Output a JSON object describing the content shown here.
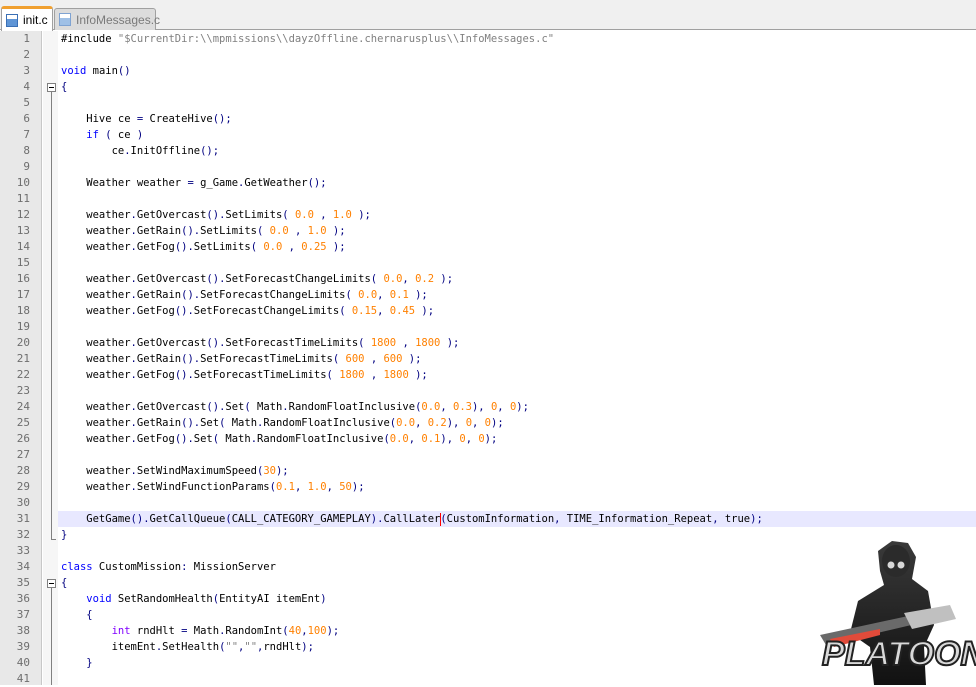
{
  "tabs": [
    {
      "label": "init.c",
      "icon": "c-file-icon",
      "active": true
    },
    {
      "label": "InfoMessages.c",
      "icon": "c-file-icon",
      "active": false
    }
  ],
  "lines": [
    {
      "n": "1",
      "t": [
        [
          "p",
          "#include "
        ],
        [
          "s",
          "\"$CurrentDir:\\\\mpmissions\\\\dayzOffline.chernarusplus\\\\InfoMessages.c\""
        ]
      ]
    },
    {
      "n": "2",
      "t": []
    },
    {
      "n": "3",
      "t": [
        [
          "k",
          "void"
        ],
        [
          "p",
          " main"
        ],
        [
          "o",
          "()"
        ]
      ]
    },
    {
      "n": "4",
      "t": [
        [
          "o",
          "{"
        ]
      ]
    },
    {
      "n": "5",
      "t": []
    },
    {
      "n": "6",
      "t": [
        [
          "p",
          "    Hive ce "
        ],
        [
          "o",
          "="
        ],
        [
          "p",
          " CreateHive"
        ],
        [
          "o",
          "();"
        ]
      ]
    },
    {
      "n": "7",
      "t": [
        [
          "p",
          "    "
        ],
        [
          "k",
          "if"
        ],
        [
          "p",
          " "
        ],
        [
          "o",
          "("
        ],
        [
          "p",
          " ce "
        ],
        [
          "o",
          ")"
        ]
      ]
    },
    {
      "n": "8",
      "t": [
        [
          "p",
          "        ce"
        ],
        [
          "o",
          "."
        ],
        [
          "p",
          "InitOffline"
        ],
        [
          "o",
          "();"
        ]
      ]
    },
    {
      "n": "9",
      "t": []
    },
    {
      "n": "10",
      "t": [
        [
          "p",
          "    Weather weather "
        ],
        [
          "o",
          "="
        ],
        [
          "p",
          " g_Game"
        ],
        [
          "o",
          "."
        ],
        [
          "p",
          "GetWeather"
        ],
        [
          "o",
          "();"
        ]
      ]
    },
    {
      "n": "11",
      "t": []
    },
    {
      "n": "12",
      "t": [
        [
          "p",
          "    weather"
        ],
        [
          "o",
          "."
        ],
        [
          "p",
          "GetOvercast"
        ],
        [
          "o",
          "()."
        ],
        [
          "p",
          "SetLimits"
        ],
        [
          "o",
          "("
        ],
        [
          "p",
          " "
        ],
        [
          "n",
          "0.0"
        ],
        [
          "p",
          " "
        ],
        [
          "o",
          ","
        ],
        [
          "p",
          " "
        ],
        [
          "n",
          "1.0"
        ],
        [
          "p",
          " "
        ],
        [
          "o",
          ");"
        ]
      ]
    },
    {
      "n": "13",
      "t": [
        [
          "p",
          "    weather"
        ],
        [
          "o",
          "."
        ],
        [
          "p",
          "GetRain"
        ],
        [
          "o",
          "()."
        ],
        [
          "p",
          "SetLimits"
        ],
        [
          "o",
          "("
        ],
        [
          "p",
          " "
        ],
        [
          "n",
          "0.0"
        ],
        [
          "p",
          " "
        ],
        [
          "o",
          ","
        ],
        [
          "p",
          " "
        ],
        [
          "n",
          "1.0"
        ],
        [
          "p",
          " "
        ],
        [
          "o",
          ");"
        ]
      ]
    },
    {
      "n": "14",
      "t": [
        [
          "p",
          "    weather"
        ],
        [
          "o",
          "."
        ],
        [
          "p",
          "GetFog"
        ],
        [
          "o",
          "()."
        ],
        [
          "p",
          "SetLimits"
        ],
        [
          "o",
          "("
        ],
        [
          "p",
          " "
        ],
        [
          "n",
          "0.0"
        ],
        [
          "p",
          " "
        ],
        [
          "o",
          ","
        ],
        [
          "p",
          " "
        ],
        [
          "n",
          "0.25"
        ],
        [
          "p",
          " "
        ],
        [
          "o",
          ");"
        ]
      ]
    },
    {
      "n": "15",
      "t": []
    },
    {
      "n": "16",
      "t": [
        [
          "p",
          "    weather"
        ],
        [
          "o",
          "."
        ],
        [
          "p",
          "GetOvercast"
        ],
        [
          "o",
          "()."
        ],
        [
          "p",
          "SetForecastChangeLimits"
        ],
        [
          "o",
          "("
        ],
        [
          "p",
          " "
        ],
        [
          "n",
          "0.0"
        ],
        [
          "o",
          ","
        ],
        [
          "p",
          " "
        ],
        [
          "n",
          "0.2"
        ],
        [
          "p",
          " "
        ],
        [
          "o",
          ");"
        ]
      ]
    },
    {
      "n": "17",
      "t": [
        [
          "p",
          "    weather"
        ],
        [
          "o",
          "."
        ],
        [
          "p",
          "GetRain"
        ],
        [
          "o",
          "()."
        ],
        [
          "p",
          "SetForecastChangeLimits"
        ],
        [
          "o",
          "("
        ],
        [
          "p",
          " "
        ],
        [
          "n",
          "0.0"
        ],
        [
          "o",
          ","
        ],
        [
          "p",
          " "
        ],
        [
          "n",
          "0.1"
        ],
        [
          "p",
          " "
        ],
        [
          "o",
          ");"
        ]
      ]
    },
    {
      "n": "18",
      "t": [
        [
          "p",
          "    weather"
        ],
        [
          "o",
          "."
        ],
        [
          "p",
          "GetFog"
        ],
        [
          "o",
          "()."
        ],
        [
          "p",
          "SetForecastChangeLimits"
        ],
        [
          "o",
          "("
        ],
        [
          "p",
          " "
        ],
        [
          "n",
          "0.15"
        ],
        [
          "o",
          ","
        ],
        [
          "p",
          " "
        ],
        [
          "n",
          "0.45"
        ],
        [
          "p",
          " "
        ],
        [
          "o",
          ");"
        ]
      ]
    },
    {
      "n": "19",
      "t": []
    },
    {
      "n": "20",
      "t": [
        [
          "p",
          "    weather"
        ],
        [
          "o",
          "."
        ],
        [
          "p",
          "GetOvercast"
        ],
        [
          "o",
          "()."
        ],
        [
          "p",
          "SetForecastTimeLimits"
        ],
        [
          "o",
          "("
        ],
        [
          "p",
          " "
        ],
        [
          "n",
          "1800"
        ],
        [
          "p",
          " "
        ],
        [
          "o",
          ","
        ],
        [
          "p",
          " "
        ],
        [
          "n",
          "1800"
        ],
        [
          "p",
          " "
        ],
        [
          "o",
          ");"
        ]
      ]
    },
    {
      "n": "21",
      "t": [
        [
          "p",
          "    weather"
        ],
        [
          "o",
          "."
        ],
        [
          "p",
          "GetRain"
        ],
        [
          "o",
          "()."
        ],
        [
          "p",
          "SetForecastTimeLimits"
        ],
        [
          "o",
          "("
        ],
        [
          "p",
          " "
        ],
        [
          "n",
          "600"
        ],
        [
          "p",
          " "
        ],
        [
          "o",
          ","
        ],
        [
          "p",
          " "
        ],
        [
          "n",
          "600"
        ],
        [
          "p",
          " "
        ],
        [
          "o",
          ");"
        ]
      ]
    },
    {
      "n": "22",
      "t": [
        [
          "p",
          "    weather"
        ],
        [
          "o",
          "."
        ],
        [
          "p",
          "GetFog"
        ],
        [
          "o",
          "()."
        ],
        [
          "p",
          "SetForecastTimeLimits"
        ],
        [
          "o",
          "("
        ],
        [
          "p",
          " "
        ],
        [
          "n",
          "1800"
        ],
        [
          "p",
          " "
        ],
        [
          "o",
          ","
        ],
        [
          "p",
          " "
        ],
        [
          "n",
          "1800"
        ],
        [
          "p",
          " "
        ],
        [
          "o",
          ");"
        ]
      ]
    },
    {
      "n": "23",
      "t": []
    },
    {
      "n": "24",
      "t": [
        [
          "p",
          "    weather"
        ],
        [
          "o",
          "."
        ],
        [
          "p",
          "GetOvercast"
        ],
        [
          "o",
          "()."
        ],
        [
          "p",
          "Set"
        ],
        [
          "o",
          "("
        ],
        [
          "p",
          " Math"
        ],
        [
          "o",
          "."
        ],
        [
          "p",
          "RandomFloatInclusive"
        ],
        [
          "o",
          "("
        ],
        [
          "n",
          "0.0"
        ],
        [
          "o",
          ","
        ],
        [
          "p",
          " "
        ],
        [
          "n",
          "0.3"
        ],
        [
          "o",
          "),"
        ],
        [
          "p",
          " "
        ],
        [
          "n",
          "0"
        ],
        [
          "o",
          ","
        ],
        [
          "p",
          " "
        ],
        [
          "n",
          "0"
        ],
        [
          "o",
          ");"
        ]
      ]
    },
    {
      "n": "25",
      "t": [
        [
          "p",
          "    weather"
        ],
        [
          "o",
          "."
        ],
        [
          "p",
          "GetRain"
        ],
        [
          "o",
          "()."
        ],
        [
          "p",
          "Set"
        ],
        [
          "o",
          "("
        ],
        [
          "p",
          " Math"
        ],
        [
          "o",
          "."
        ],
        [
          "p",
          "RandomFloatInclusive"
        ],
        [
          "o",
          "("
        ],
        [
          "n",
          "0.0"
        ],
        [
          "o",
          ","
        ],
        [
          "p",
          " "
        ],
        [
          "n",
          "0.2"
        ],
        [
          "o",
          "),"
        ],
        [
          "p",
          " "
        ],
        [
          "n",
          "0"
        ],
        [
          "o",
          ","
        ],
        [
          "p",
          " "
        ],
        [
          "n",
          "0"
        ],
        [
          "o",
          ");"
        ]
      ]
    },
    {
      "n": "26",
      "t": [
        [
          "p",
          "    weather"
        ],
        [
          "o",
          "."
        ],
        [
          "p",
          "GetFog"
        ],
        [
          "o",
          "()."
        ],
        [
          "p",
          "Set"
        ],
        [
          "o",
          "("
        ],
        [
          "p",
          " Math"
        ],
        [
          "o",
          "."
        ],
        [
          "p",
          "RandomFloatInclusive"
        ],
        [
          "o",
          "("
        ],
        [
          "n",
          "0.0"
        ],
        [
          "o",
          ","
        ],
        [
          "p",
          " "
        ],
        [
          "n",
          "0.1"
        ],
        [
          "o",
          "),"
        ],
        [
          "p",
          " "
        ],
        [
          "n",
          "0"
        ],
        [
          "o",
          ","
        ],
        [
          "p",
          " "
        ],
        [
          "n",
          "0"
        ],
        [
          "o",
          ");"
        ]
      ]
    },
    {
      "n": "27",
      "t": []
    },
    {
      "n": "28",
      "t": [
        [
          "p",
          "    weather"
        ],
        [
          "o",
          "."
        ],
        [
          "p",
          "SetWindMaximumSpeed"
        ],
        [
          "o",
          "("
        ],
        [
          "n",
          "30"
        ],
        [
          "o",
          ");"
        ]
      ]
    },
    {
      "n": "29",
      "t": [
        [
          "p",
          "    weather"
        ],
        [
          "o",
          "."
        ],
        [
          "p",
          "SetWindFunctionParams"
        ],
        [
          "o",
          "("
        ],
        [
          "n",
          "0.1"
        ],
        [
          "o",
          ","
        ],
        [
          "p",
          " "
        ],
        [
          "n",
          "1.0"
        ],
        [
          "o",
          ","
        ],
        [
          "p",
          " "
        ],
        [
          "n",
          "50"
        ],
        [
          "o",
          ");"
        ]
      ]
    },
    {
      "n": "30",
      "t": []
    },
    {
      "n": "31",
      "t": [
        [
          "p",
          "    GetGame"
        ],
        [
          "o",
          "()."
        ],
        [
          "p",
          "GetCallQueue"
        ],
        [
          "o",
          "("
        ],
        [
          "p",
          "CALL_CATEGORY_GAMEPLAY"
        ],
        [
          "o",
          ")."
        ],
        [
          "p",
          "CallLater"
        ],
        [
          "c",
          ""
        ],
        [
          "o",
          "("
        ],
        [
          "p",
          "CustomInformation"
        ],
        [
          "o",
          ","
        ],
        [
          "p",
          " TIME_Information_Repeat"
        ],
        [
          "o",
          ","
        ],
        [
          "p",
          " true"
        ],
        [
          "o",
          ");"
        ]
      ]
    },
    {
      "n": "32",
      "t": [
        [
          "o",
          "}"
        ]
      ]
    },
    {
      "n": "33",
      "t": []
    },
    {
      "n": "34",
      "t": [
        [
          "k",
          "class"
        ],
        [
          "p",
          " CustomMission"
        ],
        [
          "o",
          ":"
        ],
        [
          "p",
          " MissionServer"
        ]
      ]
    },
    {
      "n": "35",
      "t": [
        [
          "o",
          "{"
        ]
      ]
    },
    {
      "n": "36",
      "t": [
        [
          "p",
          "    "
        ],
        [
          "k",
          "void"
        ],
        [
          "p",
          " SetRandomHealth"
        ],
        [
          "o",
          "("
        ],
        [
          "p",
          "EntityAI itemEnt"
        ],
        [
          "o",
          ")"
        ]
      ]
    },
    {
      "n": "37",
      "t": [
        [
          "p",
          "    "
        ],
        [
          "o",
          "{"
        ]
      ]
    },
    {
      "n": "38",
      "t": [
        [
          "p",
          "        "
        ],
        [
          "y",
          "int"
        ],
        [
          "p",
          " rndHlt "
        ],
        [
          "o",
          "="
        ],
        [
          "p",
          " Math"
        ],
        [
          "o",
          "."
        ],
        [
          "p",
          "RandomInt"
        ],
        [
          "o",
          "("
        ],
        [
          "n",
          "40"
        ],
        [
          "o",
          ","
        ],
        [
          "n",
          "100"
        ],
        [
          "o",
          ");"
        ]
      ]
    },
    {
      "n": "39",
      "t": [
        [
          "p",
          "        itemEnt"
        ],
        [
          "o",
          "."
        ],
        [
          "p",
          "SetHealth"
        ],
        [
          "o",
          "("
        ],
        [
          "s",
          "\"\""
        ],
        [
          "o",
          ","
        ],
        [
          "s",
          "\"\""
        ],
        [
          "o",
          ","
        ],
        [
          "p",
          "rndHlt"
        ],
        [
          "o",
          ");"
        ]
      ]
    },
    {
      "n": "40",
      "t": [
        [
          "p",
          "    "
        ],
        [
          "o",
          "}"
        ]
      ]
    },
    {
      "n": "41",
      "t": []
    }
  ],
  "current_line": "31",
  "colors": {
    "keyword": "#0000ff",
    "number": "#ff8000",
    "string": "#808080",
    "operator": "#000080",
    "type": "#8000ff",
    "current_line_bg": "#e8e8ff",
    "caret": "#ff0000"
  },
  "logo": {
    "text": "PLATOON",
    "icon": "soldier-mascot-logo"
  }
}
